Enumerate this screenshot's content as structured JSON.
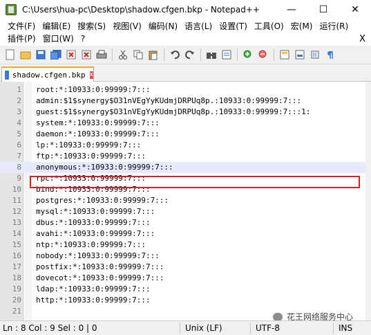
{
  "window": {
    "title": "C:\\Users\\hua-pc\\Desktop\\shadow.cfgen.bkp - Notepad++",
    "minimize": "—",
    "maximize": "☐",
    "close": "✕"
  },
  "menu": {
    "row1": [
      "文件(F)",
      "编辑(E)",
      "搜索(S)",
      "视图(V)",
      "编码(N)",
      "语言(L)",
      "设置(T)",
      "工具(O)",
      "宏(M)",
      "运行(R)"
    ],
    "row2": [
      "插件(P)",
      "窗口(W)",
      "?"
    ],
    "close_doc": "X"
  },
  "tab": {
    "label": "shadow.cfgen.bkp",
    "close": "x"
  },
  "editor": {
    "current_line": 8,
    "highlighted_line": 2,
    "lines": [
      "root:*:10933:0:99999:7:::",
      "admin:$1$synergy$O31nVEgYyKUdmjDRPUq8p.:10933:0:99999:7:::",
      "guest:$1$synergy$O31nVEgYyKUdmjDRPUq8p.:10933:0:99999:7:::1:",
      "system:*:10933:0:99999:7:::",
      "daemon:*:10933:0:99999:7:::",
      "lp:*:10933:0:99999:7:::",
      "ftp:*:10933:0:99999:7:::",
      "anonymous:*:10933:0:99999:7:::",
      "rpc:*:10933:0:99999:7:::",
      "bind:*:10933:0:99999:7:::",
      "postgres:*:10933:0:99999:7:::",
      "mysql:*:10933:0:99999:7:::",
      "dbus:*:10933:0:99999:7:::",
      "avahi:*:10933:0:99999:7:::",
      "ntp:*:10933:0:99999:7:::",
      "nobody:*:10933:0:99999:7:::",
      "postfix:*:10933:0:99999:7:::",
      "dovecot:*:10933:0:99999:7:::",
      "ldap:*:10933:0:99999:7:::",
      "http:*:10933:0:99999:7:::"
    ],
    "line_numbers": [
      "1",
      "2",
      "3",
      "4",
      "5",
      "6",
      "7",
      "8",
      "9",
      "10",
      "11",
      "12",
      "13",
      "14",
      "15",
      "16",
      "17",
      "18",
      "19",
      "20",
      "21"
    ]
  },
  "status": {
    "position": "Ln : 8    Col : 9    Sel : 0 | 0",
    "eol": "Unix (LF)",
    "encoding": "UTF-8",
    "mode": "INS"
  },
  "watermark": "花王网络服务中心"
}
